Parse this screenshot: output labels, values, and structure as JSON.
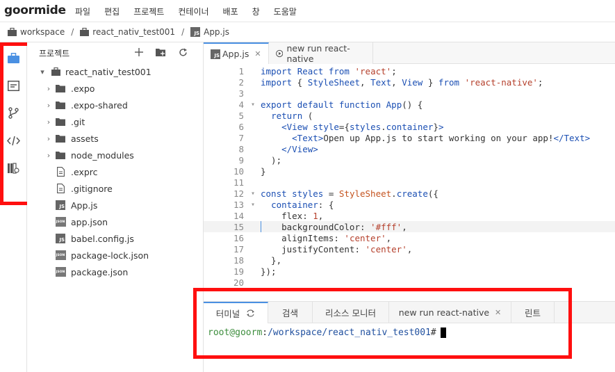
{
  "app": {
    "logo": "goormide"
  },
  "menu": [
    "파일",
    "편집",
    "프로젝트",
    "컨테이너",
    "배포",
    "창",
    "도움말"
  ],
  "breadcrumb": {
    "items": [
      "workspace",
      "react_nativ_test001",
      "App.js"
    ],
    "separator": "/"
  },
  "sidebar_rail": {
    "icons": [
      "briefcase-icon",
      "panel-icon",
      "git-branch-icon",
      "code-icon",
      "library-icon"
    ]
  },
  "explorer": {
    "title": "프로젝트",
    "root": "react_nativ_test001",
    "items": [
      {
        "name": ".expo",
        "type": "folder"
      },
      {
        "name": ".expo-shared",
        "type": "folder"
      },
      {
        "name": ".git",
        "type": "folder"
      },
      {
        "name": "assets",
        "type": "folder"
      },
      {
        "name": "node_modules",
        "type": "folder"
      },
      {
        "name": ".exprc",
        "type": "file"
      },
      {
        "name": ".gitignore",
        "type": "file"
      },
      {
        "name": "App.js",
        "type": "js"
      },
      {
        "name": "app.json",
        "type": "json"
      },
      {
        "name": "babel.config.js",
        "type": "js"
      },
      {
        "name": "package-lock.json",
        "type": "json"
      },
      {
        "name": "package.json",
        "type": "json"
      }
    ]
  },
  "editor_tabs": [
    {
      "label": "App.js",
      "active": true
    },
    {
      "label": "new run react-native",
      "active": false
    }
  ],
  "code": {
    "line_numbers": [
      "1",
      "2",
      "3",
      "4",
      "5",
      "6",
      "7",
      "8",
      "9",
      "10",
      "11",
      "12",
      "13",
      "14",
      "15",
      "16",
      "17",
      "18",
      "19",
      "20"
    ],
    "highlighted_line": 15
  },
  "bottom_tabs": [
    {
      "label": "터미널",
      "active": true
    },
    {
      "label": "검색",
      "active": false
    },
    {
      "label": "리소스 모니터",
      "active": false
    },
    {
      "label": "new run react-native",
      "active": false
    },
    {
      "label": "린트",
      "active": false
    }
  ],
  "terminal": {
    "user": "root@goorm",
    "colon": ":",
    "path": "/workspace/react_nativ_test001",
    "prompt": "#"
  },
  "colors": {
    "highlight": "#ff0f0f",
    "accent": "#4a90e2"
  }
}
